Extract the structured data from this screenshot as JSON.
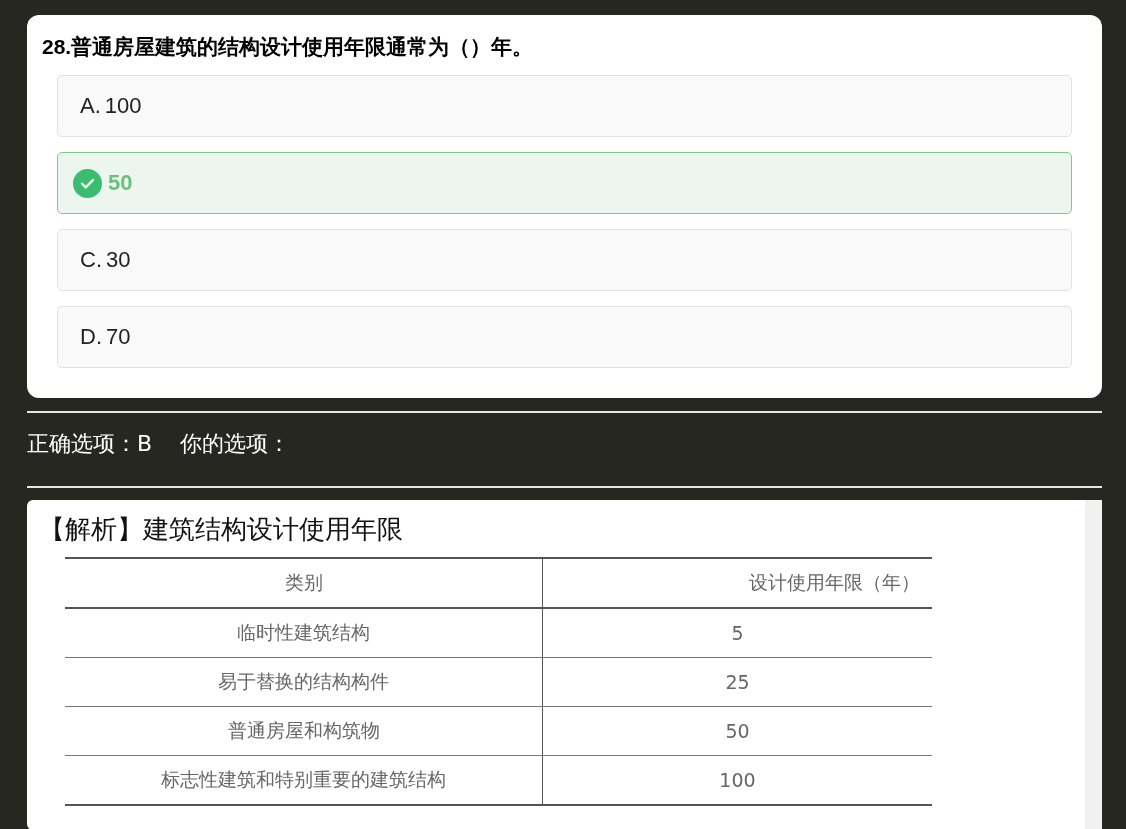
{
  "question": {
    "title": "28.普通房屋建筑的结构设计使用年限通常为（）年。",
    "options": [
      {
        "label": "A.",
        "text": "100",
        "selected": false
      },
      {
        "text": "50",
        "selected": true
      },
      {
        "label": "C.",
        "text": "30",
        "selected": false
      },
      {
        "label": "D.",
        "text": "70",
        "selected": false
      }
    ]
  },
  "answer_line": {
    "correct": "正确选项：B",
    "yours": "你的选项："
  },
  "analysis": {
    "heading": "【解析】建筑结构设计使用年限",
    "table": {
      "columns": [
        "类别",
        "设计使用年限（年）"
      ],
      "rows": [
        [
          "临时性建筑结构",
          "5"
        ],
        [
          "易于替换的结构构件",
          "25"
        ],
        [
          "普通房屋和构筑物",
          "50"
        ],
        [
          "标志性建筑和特别重要的建筑结构",
          "100"
        ]
      ]
    }
  }
}
